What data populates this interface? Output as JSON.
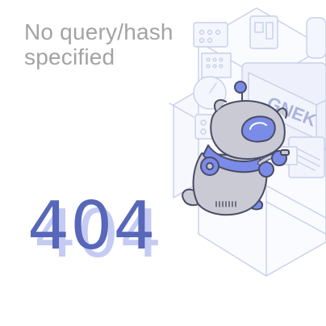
{
  "error": {
    "message": "No query/hash specified",
    "code": "404"
  },
  "illustration": {
    "screen_text": "GNEK",
    "mascot_icon": "robot-mascot-icon",
    "machine_icon": "server-machine-icon"
  },
  "colors": {
    "message_text": "#a3a3a3",
    "code_primary": "#5767b9",
    "code_shadow": "#c5cbf2",
    "line_art": "#c7d0ea",
    "mascot_body": "#c9cad3",
    "mascot_accent": "#7b8be8"
  }
}
